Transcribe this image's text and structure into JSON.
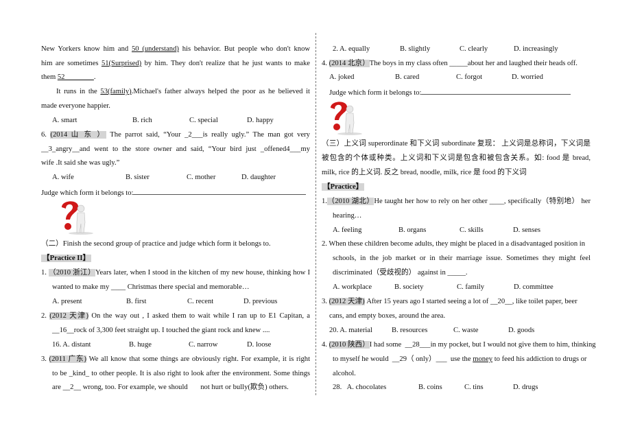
{
  "left": {
    "l1": {
      "a": "New Yorkers know him and ",
      "b": "50 (understand)",
      "c": " his behavior. But people who don't know"
    },
    "l2": {
      "a": "him are sometimes ",
      "b": "51(Surprised)",
      "c": " by him. They don't realize that he just wants to make"
    },
    "l3": {
      "a": "them ",
      "b": "52________",
      "c": "."
    },
    "l4": {
      "a": "It runs in the ",
      "b": "53(family)",
      "c": ".Michael's father always helped the poor as he believed it"
    },
    "l5": "made everyone happier.",
    "o1": [
      "A. smart",
      "B. rich",
      "C. special",
      "D. happy"
    ],
    "q6": {
      "num": "6. ",
      "tag": "(2014 山 东 ）",
      "a": " The parrot said, “Your _2___is really ugly.” The man got very"
    },
    "q6b": "__3_angry__and went to the store owner and said, “Your bird just _offened4___my",
    "q6c": "wife .It said she was ugly.”",
    "o2": [
      "A. wife",
      "B. sister",
      "C. mother",
      "D. daughter"
    ],
    "judge": "Judge which form it belongs to:",
    "sec2": "（二）Finish the second group of practice and judge which form it belongs to.",
    "practice2": "【Practice II】",
    "p1": {
      "num": "1. ",
      "tag": "（2010 浙江）",
      "a": "Years later, when I stood in the kitchen of my new house, thinking how I"
    },
    "p1b": "wanted to make my ____ Christmas there special and memorable…",
    "o3": [
      "A. present",
      "B. first",
      "C. recent",
      "D. previous"
    ],
    "p2": {
      "num": "2. ",
      "tag": "(2012 天津)",
      "a": " On the way out , I asked them to wait while I ran up to E1 Capitan, a"
    },
    "p2b": "__16__rock of 3,300 feet straight up. I touched the giant rock and knew ....",
    "o4": [
      "16. A. distant",
      "B. huge",
      "C. narrow",
      "D. loose"
    ],
    "p3": {
      "num": "3. ",
      "tag": "(2011 广东)",
      "a": " We all know that some things are obviously right. For example, it is right"
    },
    "p3b": "to be _kind_ to other people. It is also right to look after the environment. Some things",
    "p3c": "are __2__ wrong, too. For example, we should       not hurt or bully(欺负) others."
  },
  "right": {
    "o0": [
      "2. A. equally",
      "B. slightly",
      "C. clearly",
      "D. increasingly"
    ],
    "q4": {
      "num": "4. ",
      "tag": "(2014 北京）",
      "a": "The boys in my class often _____about her and laughed their heads off."
    },
    "o1": [
      "A. joked",
      "B. cared",
      "C. forgot",
      "D. worried"
    ],
    "judge": "Judge which form it belongs to:",
    "sec3a": "（三）上义词 superordinate 和下义词 subordinate 复现：  上义词是总称词，下义词是",
    "sec3b": "被包含的个体或种类。上义词和下义词是包含和被包含关系。如: food 是 bread, noodle,",
    "sec3c": "milk, rice 的上义词. 反之 bread, noodle, milk, rice 是 food 的下义词",
    "practice": "【Practice】",
    "r1": {
      "num": "1.",
      "tag": "（2010  湖北）",
      "a": "He taught her how to rely on her other ____, specifically（特别地）  her"
    },
    "r1b": "hearing…",
    "o2": [
      "A. feeling",
      "B. organs",
      "C. skills",
      "D. senses"
    ],
    "r2": "2. When these children become adults, they might be placed in a disadvantaged position in",
    "r2b": "schools, in the job market or in their marriage issue. Sometimes they might feel",
    "r2c": "discriminated（受歧视的）  against in _____.",
    "o3": [
      "A. workplace",
      "B. society",
      "C. family",
      "D. committee"
    ],
    "r3": {
      "num": "3. ",
      "tag": "(2012 天津)",
      "a": " After 15 years ago I started seeing a lot of __20__, like toilet paper, beer"
    },
    "r3b": "cans, and empty boxes, around the area.",
    "o4": [
      "20. A. material",
      "B. resources",
      "C. waste",
      "D. goods"
    ],
    "r4": {
      "num": "4. ",
      "tag": "(2010 陕西）",
      "a": "I had some  __28___in my pocket, but I would not give them to him, thinking"
    },
    "r4b": {
      "a": "to myself he would  __29（ only）___  use the ",
      "b": "money",
      "c": " to feed his addiction to drugs or"
    },
    "r4c": "alcohol.",
    "o5": [
      "28.   A. chocolates",
      "B. coins",
      "C. tins",
      "D. drugs"
    ]
  },
  "colors": {
    "tag_bg": "#d4d4d4",
    "question_mark": "#d01818"
  },
  "icons": [
    "question-mark-figure-icon"
  ]
}
